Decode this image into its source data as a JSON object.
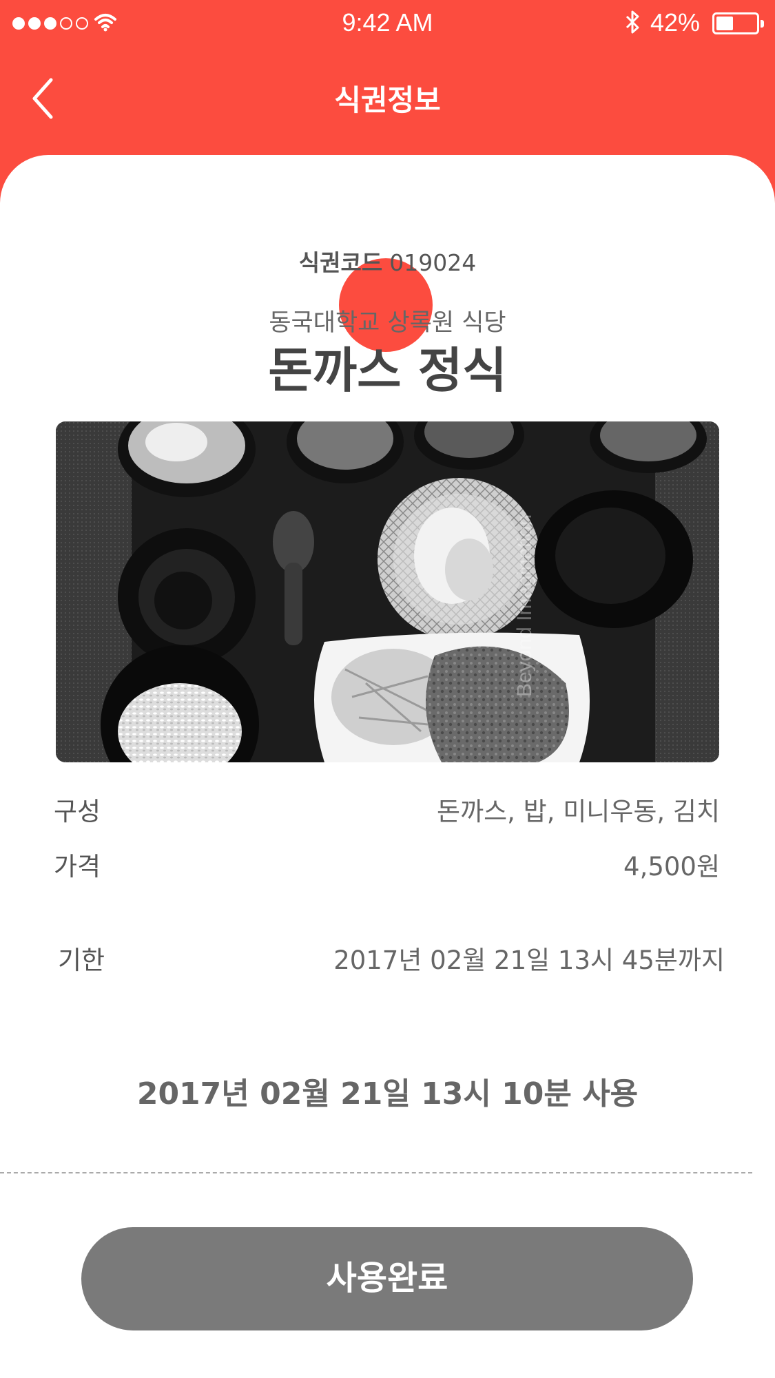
{
  "status_bar": {
    "time": "9:42 AM",
    "battery_percent_text": "42%",
    "battery_level": 0.42,
    "signal_bars_filled": 3,
    "signal_bars_total": 5
  },
  "nav": {
    "title": "식권정보",
    "back_icon": "chevron-left-icon"
  },
  "ticket": {
    "code_label": "식권코드",
    "code_value": "019024",
    "restaurant": "동국대학교 상록원 식당",
    "menu_name": "돈까스 정식",
    "details": [
      {
        "label": "구성",
        "value": "돈까스, 밥, 미니우동, 김치"
      },
      {
        "label": "가격",
        "value": "4,500원"
      },
      {
        "label": "기한",
        "value": "2017년 02월 21일 13시 45분까지"
      }
    ],
    "used_at": "2017년 02월 21일 13시 10분 사용"
  },
  "photo": {
    "watermark": "Beyond Imagination"
  },
  "action": {
    "button_label": "사용완료"
  },
  "colors": {
    "brand": "#fc4c3f",
    "button": "#7a7a7a"
  }
}
